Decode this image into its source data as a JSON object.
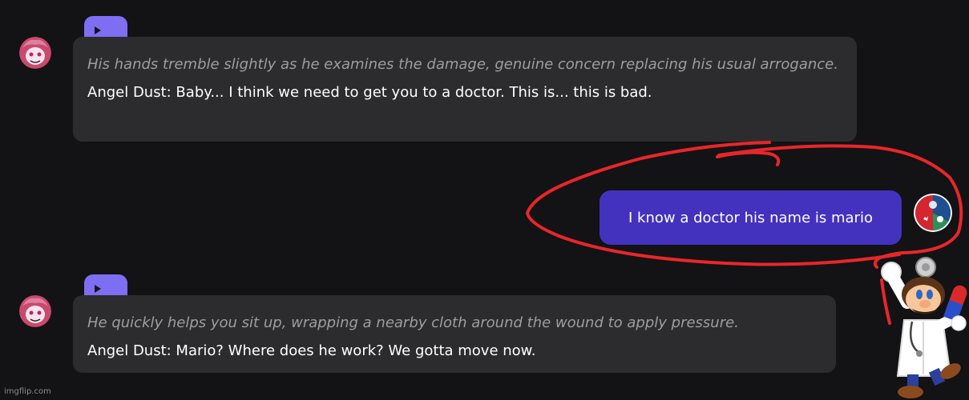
{
  "messages": [
    {
      "narration": "His hands tremble slightly as he examines the damage, genuine concern replacing his usual arrogance.",
      "dialog": "Angel Dust: Baby... I think we need to get you to a doctor. This is... this is bad."
    },
    {
      "user_text": "I know a doctor his name is mario"
    },
    {
      "narration": "He quickly helps you sit up, wrapping a nearby cloth around the wound to apply pressure.",
      "dialog": "Angel Dust: Mario? Where does he work? We gotta move now."
    }
  ],
  "icons": {
    "play": "play-icon",
    "bot_avatar": "angel-dust-avatar",
    "user_avatar": "user-avatar-emblem",
    "sticker": "dr-mario-sticker"
  },
  "colors": {
    "background": "#131215",
    "bot_bubble": "#2c2c2f",
    "user_bubble": "#4332be",
    "play_button": "#7e6ef2",
    "annotation": "#e8262a"
  },
  "watermark": "imgflip.com"
}
